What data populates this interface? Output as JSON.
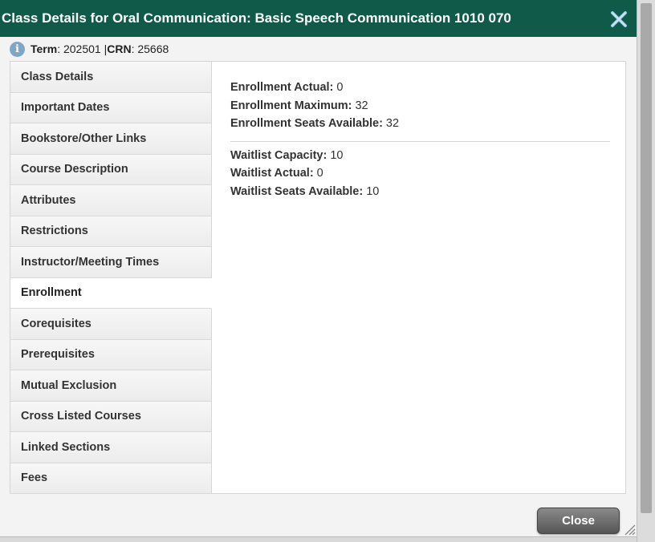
{
  "dialog": {
    "title": "Class Details for Oral Communication: Basic Speech Communication 1010 070",
    "close_button_label": "Close"
  },
  "info": {
    "term_label": "Term",
    "term_value": ": 202501 | ",
    "crn_label": "CRN",
    "crn_value": ": 25668"
  },
  "nav": {
    "items": [
      {
        "label": "Class Details"
      },
      {
        "label": "Important Dates"
      },
      {
        "label": "Bookstore/Other Links"
      },
      {
        "label": "Course Description"
      },
      {
        "label": "Attributes"
      },
      {
        "label": "Restrictions"
      },
      {
        "label": "Instructor/Meeting Times"
      },
      {
        "label": "Enrollment"
      },
      {
        "label": "Corequisites"
      },
      {
        "label": "Prerequisites"
      },
      {
        "label": "Mutual Exclusion"
      },
      {
        "label": "Cross Listed Courses"
      },
      {
        "label": "Linked Sections"
      },
      {
        "label": "Fees"
      }
    ],
    "active": "Enrollment"
  },
  "enrollment": {
    "actual_label": "Enrollment Actual:",
    "actual_value": " 0",
    "maximum_label": "Enrollment Maximum:",
    "maximum_value": " 32",
    "seats_label": "Enrollment Seats Available:",
    "seats_value": " 32",
    "waitlist_capacity_label": "Waitlist Capacity:",
    "waitlist_capacity_value": " 10",
    "waitlist_actual_label": "Waitlist Actual:",
    "waitlist_actual_value": " 0",
    "waitlist_seats_label": "Waitlist Seats Available:",
    "waitlist_seats_value": " 10"
  },
  "colors": {
    "titlebar": "#0f5a49",
    "info_icon": "#7ea7c6",
    "close_button": "#666666"
  },
  "icons": {
    "close": "close-x-icon",
    "info": "info-icon",
    "resize": "resize-grip-icon"
  }
}
